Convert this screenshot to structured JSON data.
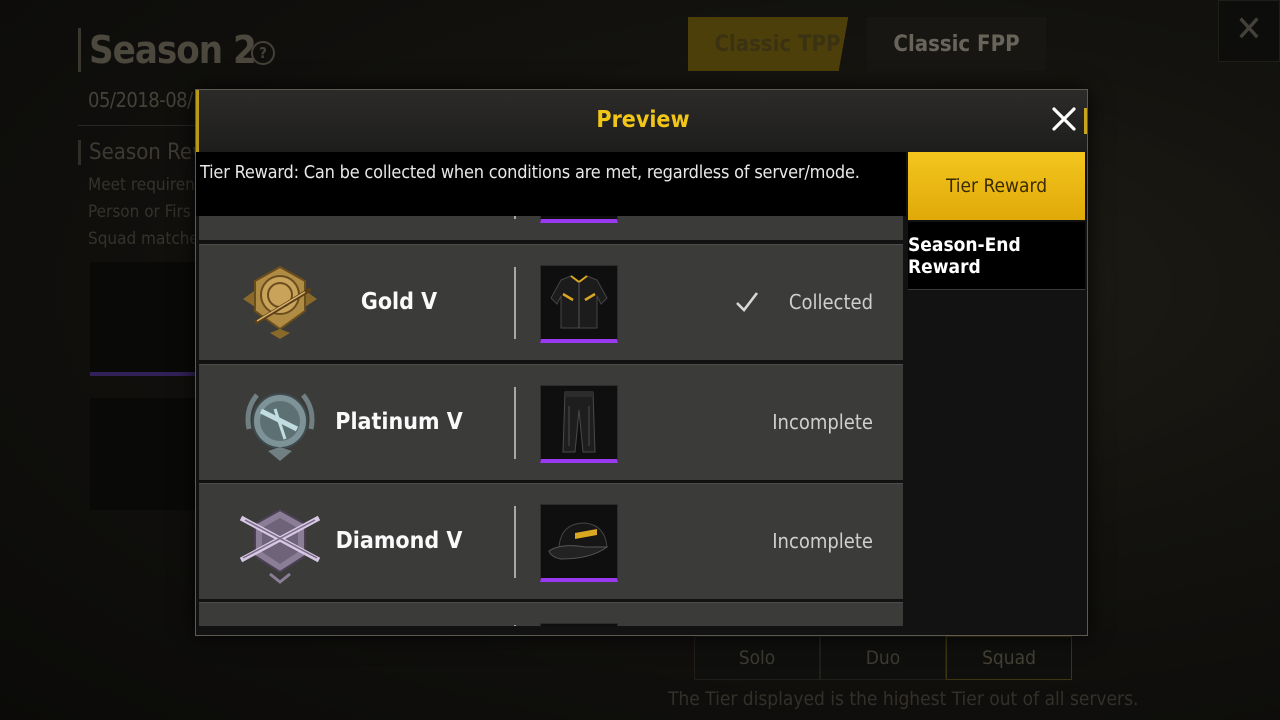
{
  "background": {
    "season_title": "Season 2",
    "season_dates": "05/2018-08/",
    "season_reward_heading": "Season Rew",
    "description_lines": [
      "Meet requiren",
      "Person or Firs",
      "Squad matche"
    ],
    "mode_tabs": [
      {
        "label": "Classic TPP",
        "active": true
      },
      {
        "label": "Classic FPP",
        "active": false
      }
    ],
    "team_tabs": [
      {
        "label": "Solo",
        "active": false
      },
      {
        "label": "Duo",
        "active": false
      },
      {
        "label": "Squad",
        "active": true
      }
    ],
    "tier_note": "The Tier displayed is the highest Tier out of all servers."
  },
  "modal": {
    "title": "Preview",
    "tip": "Tier Reward: Can be collected when conditions are met, regardless of server/mode.",
    "side_tabs": [
      {
        "label": "Tier Reward",
        "active": true
      },
      {
        "label": "Season-End Reward",
        "active": false
      }
    ],
    "rows": [
      {
        "tier": "Gold V",
        "badge": "gold-tier-badge-icon",
        "reward": "jacket",
        "status": "Collected",
        "collected": true
      },
      {
        "tier": "Platinum V",
        "badge": "platinum-tier-badge-icon",
        "reward": "pants",
        "status": "Incomplete",
        "collected": false
      },
      {
        "tier": "Diamond V",
        "badge": "diamond-tier-badge-icon",
        "reward": "cap",
        "status": "Incomplete",
        "collected": false
      }
    ]
  },
  "colors": {
    "accent_yellow": "#f2c617",
    "rarity_purple": "#9a3af0",
    "row_bg": "#3b3b3a"
  }
}
